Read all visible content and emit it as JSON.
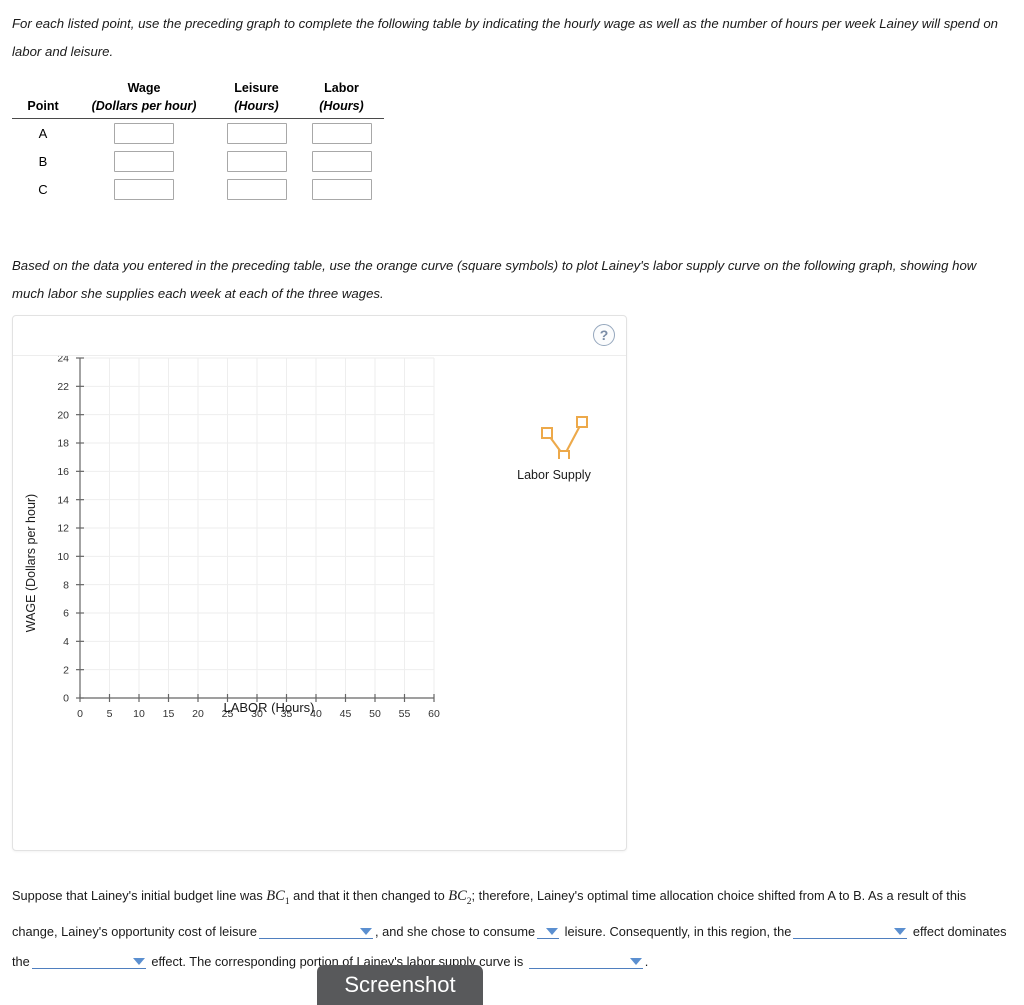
{
  "prompts": {
    "table_intro": "For each listed point, use the preceding graph to complete the following table by indicating the hourly wage as well as the number of hours per week Lainey will spend on labor and leisure.",
    "graph_intro": "Based on the data you entered in the preceding table, use the orange curve (square symbols) to plot Lainey's labor supply curve on the following graph, showing how much labor she supplies each week at each of the three wages."
  },
  "table": {
    "headers": {
      "point": "Point",
      "wage": "Wage",
      "wage_unit": "(Dollars per hour)",
      "leisure": "Leisure",
      "leisure_unit": "(Hours)",
      "labor": "Labor",
      "labor_unit": "(Hours)"
    },
    "rows": [
      {
        "point": "A",
        "wage": "",
        "leisure": "",
        "labor": ""
      },
      {
        "point": "B",
        "wage": "",
        "leisure": "",
        "labor": ""
      },
      {
        "point": "C",
        "wage": "",
        "leisure": "",
        "labor": ""
      }
    ]
  },
  "graph_panel": {
    "help_glyph": "?",
    "legend_label": "Labor Supply"
  },
  "chart_data": {
    "type": "scatter",
    "title": "",
    "xlabel": "LABOR (Hours)",
    "ylabel": "WAGE (Dollars per hour)",
    "xlim": [
      0,
      60
    ],
    "ylim": [
      0,
      24
    ],
    "xticks": [
      0,
      5,
      10,
      15,
      20,
      25,
      30,
      35,
      40,
      45,
      50,
      55,
      60
    ],
    "yticks": [
      0,
      2,
      4,
      6,
      8,
      10,
      12,
      14,
      16,
      18,
      20,
      22,
      24
    ],
    "grid": true,
    "legend_position": "right",
    "series": [
      {
        "name": "Labor Supply",
        "color": "#f0a23c",
        "marker": "square",
        "values": []
      }
    ]
  },
  "closing": {
    "seg1": "Suppose that Lainey's initial budget line was ",
    "bc1": "BC",
    "bc1_sub": "1",
    "seg2": " and that it then changed to ",
    "bc2": "BC",
    "bc2_sub": "2",
    "seg3": "; therefore, Lainey's optimal time allocation choice shifted from A to B. As a result of this change, Lainey's opportunity cost of leisure",
    "seg4": ", and she chose to consume",
    "seg5": "leisure. Consequently, in this region, the",
    "seg6": "effect dominates the",
    "seg7": "effect. The corresponding portion of Lainey's labor supply curve is",
    "seg8": "."
  },
  "screenshot_button": {
    "label": "Screenshot"
  }
}
